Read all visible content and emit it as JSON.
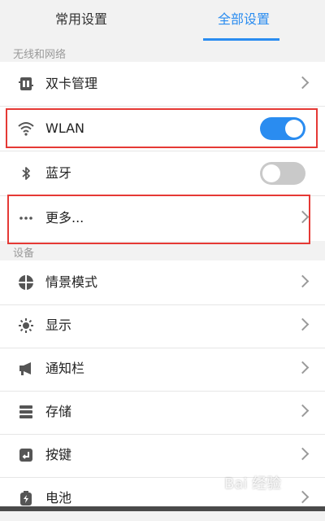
{
  "tabs": [
    {
      "label": "常用设置",
      "active": false
    },
    {
      "label": "全部设置",
      "active": true
    }
  ],
  "accent_color": "#2a8cf0",
  "sections": {
    "network": "无线和网络",
    "device": "设备"
  },
  "network_items": [
    {
      "label": "双卡管理",
      "icon": "dual-sim-icon",
      "control": "chevron"
    },
    {
      "label": "WLAN",
      "icon": "wifi-icon",
      "control": "toggle",
      "toggle_on": true
    },
    {
      "label": "蓝牙",
      "icon": "bluetooth-icon",
      "control": "toggle",
      "toggle_on": false
    },
    {
      "label": "更多...",
      "icon": "more-dots-icon",
      "control": "chevron"
    }
  ],
  "device_items": [
    {
      "label": "情景模式",
      "icon": "profile-icon"
    },
    {
      "label": "显示",
      "icon": "brightness-icon"
    },
    {
      "label": "通知栏",
      "icon": "megaphone-icon"
    },
    {
      "label": "存储",
      "icon": "storage-icon"
    },
    {
      "label": "按键",
      "icon": "key-icon"
    },
    {
      "label": "电池",
      "icon": "battery-icon"
    }
  ],
  "watermark": "Bai 经验"
}
